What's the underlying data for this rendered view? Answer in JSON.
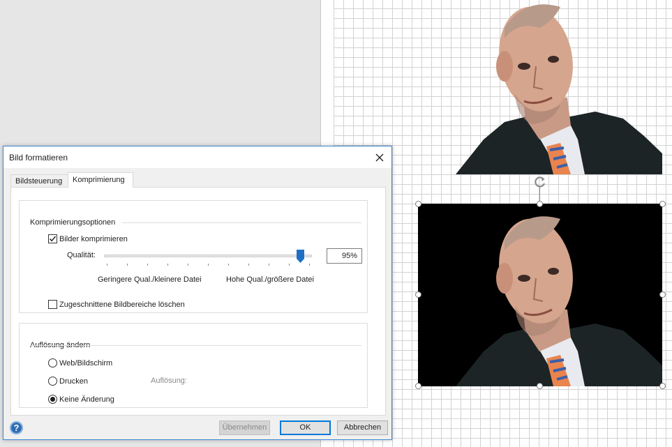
{
  "dialog": {
    "title": "Bild formatieren",
    "close_icon": "close-icon",
    "tabs": [
      {
        "label": "Bildsteuerung",
        "active": false
      },
      {
        "label": "Komprimierung",
        "active": true
      }
    ],
    "compression_group": {
      "title": "Komprimierungsoptionen",
      "compress_checkbox": {
        "label": "Bilder komprimieren",
        "checked": true
      },
      "quality": {
        "label": "Qualität:",
        "value_text": "95%",
        "value_percent": 95,
        "min_label": "Geringere Qual./kleinere Datei",
        "max_label": "Hohe Qual./größere Datei"
      },
      "delete_cropped_checkbox": {
        "label": "Zugeschnittene Bildbereiche löschen",
        "checked": false
      }
    },
    "resolution_group": {
      "title": "Auflösung ändern",
      "options": [
        {
          "label": "Web/Bildschirm",
          "selected": false
        },
        {
          "label": "Drucken",
          "selected": false
        },
        {
          "label": "Keine Änderung",
          "selected": true
        }
      ],
      "resolution_label": "Auflösung:"
    },
    "buttons": {
      "apply": "Übernehmen",
      "ok": "OK",
      "cancel": "Abbrechen",
      "help": "?"
    }
  },
  "colors": {
    "accent": "#0078d7",
    "slider_thumb": "#1f6fc5",
    "photo_background": "#000000"
  }
}
